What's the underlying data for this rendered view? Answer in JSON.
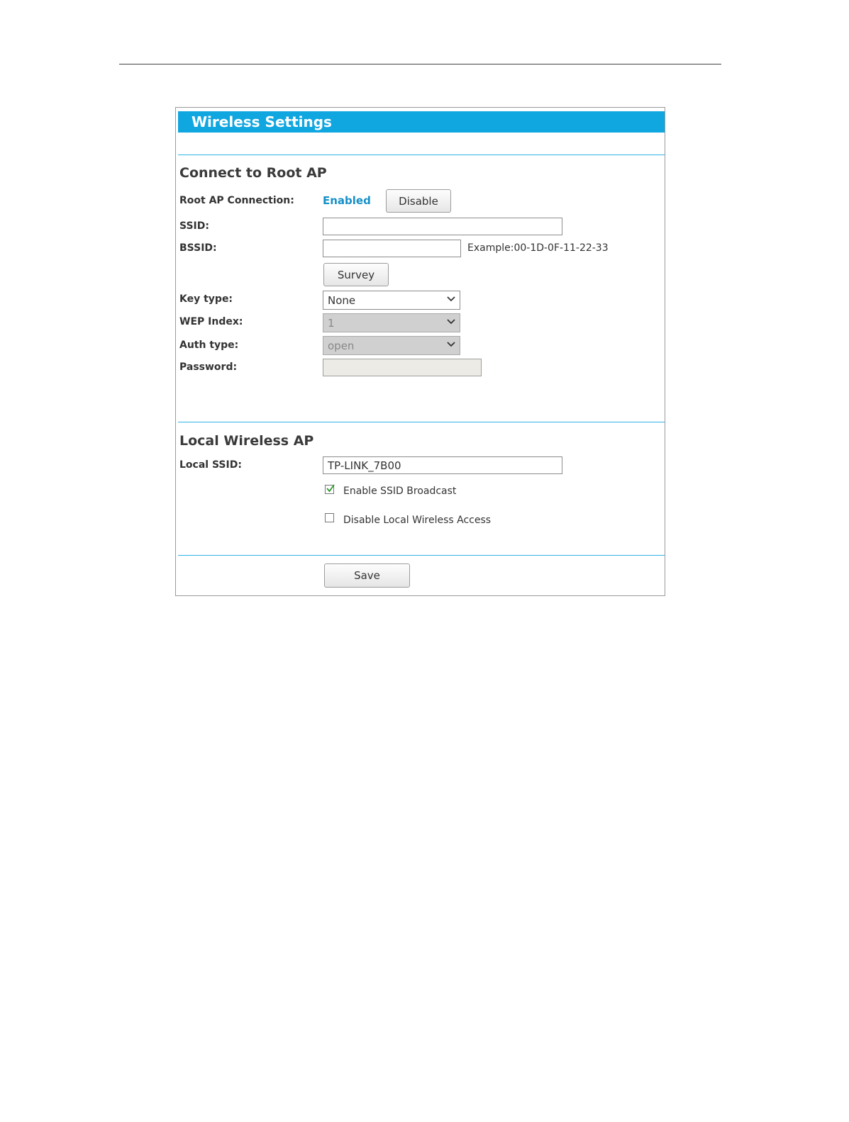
{
  "panel": {
    "title": "Wireless Settings"
  },
  "root_ap": {
    "section_title": "Connect to Root AP",
    "connection_label": "Root AP Connection:",
    "connection_status": "Enabled",
    "disable_button": "Disable",
    "ssid_label": "SSID:",
    "ssid_value": "",
    "bssid_label": "BSSID:",
    "bssid_value": "",
    "bssid_hint": "Example:00-1D-0F-11-22-33",
    "survey_button": "Survey",
    "key_type_label": "Key type:",
    "key_type_value": "None",
    "wep_index_label": "WEP Index:",
    "wep_index_value": "1",
    "auth_type_label": "Auth type:",
    "auth_type_value": "open",
    "password_label": "Password:",
    "password_value": ""
  },
  "local_ap": {
    "section_title": "Local Wireless AP",
    "local_ssid_label": "Local SSID:",
    "local_ssid_value": "TP-LINK_7B00",
    "enable_broadcast_label": "Enable SSID Broadcast",
    "enable_broadcast_checked": true,
    "disable_local_label": "Disable Local Wireless Access",
    "disable_local_checked": false
  },
  "footer": {
    "save_button": "Save"
  },
  "colors": {
    "accent": "#10a6e0",
    "status": "#1690c8",
    "check": "#2e9a2e"
  },
  "icons": {
    "select_arrow": "chevron-down-icon",
    "checkmark": "checkmark-icon"
  }
}
